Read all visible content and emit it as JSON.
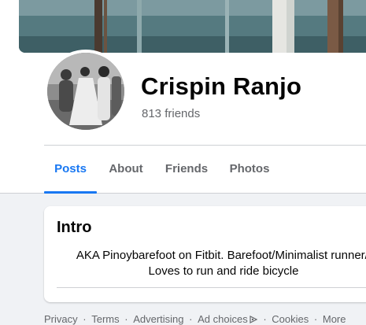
{
  "profile": {
    "name": "Crispin Ranjo",
    "friends": "813 friends"
  },
  "tabs": [
    {
      "label": "Posts",
      "active": true
    },
    {
      "label": "About",
      "active": false
    },
    {
      "label": "Friends",
      "active": false
    },
    {
      "label": "Photos",
      "active": false
    }
  ],
  "intro": {
    "title": "Intro",
    "bio_line1": "AKA Pinoybarefoot on Fitbit. Barefoot/Minimalist runner/l",
    "bio_line2": "Loves to run and ride bicycle"
  },
  "footer": {
    "privacy": "Privacy",
    "terms": "Terms",
    "advertising": "Advertising",
    "ad_choices": "Ad choices",
    "ad_choices_icon": "ad-choices-icon",
    "cookies": "Cookies",
    "more": "More",
    "separator": "·"
  },
  "colors": {
    "accent": "#1877f2",
    "secondary_text": "#65676b",
    "background": "#f0f2f5"
  }
}
